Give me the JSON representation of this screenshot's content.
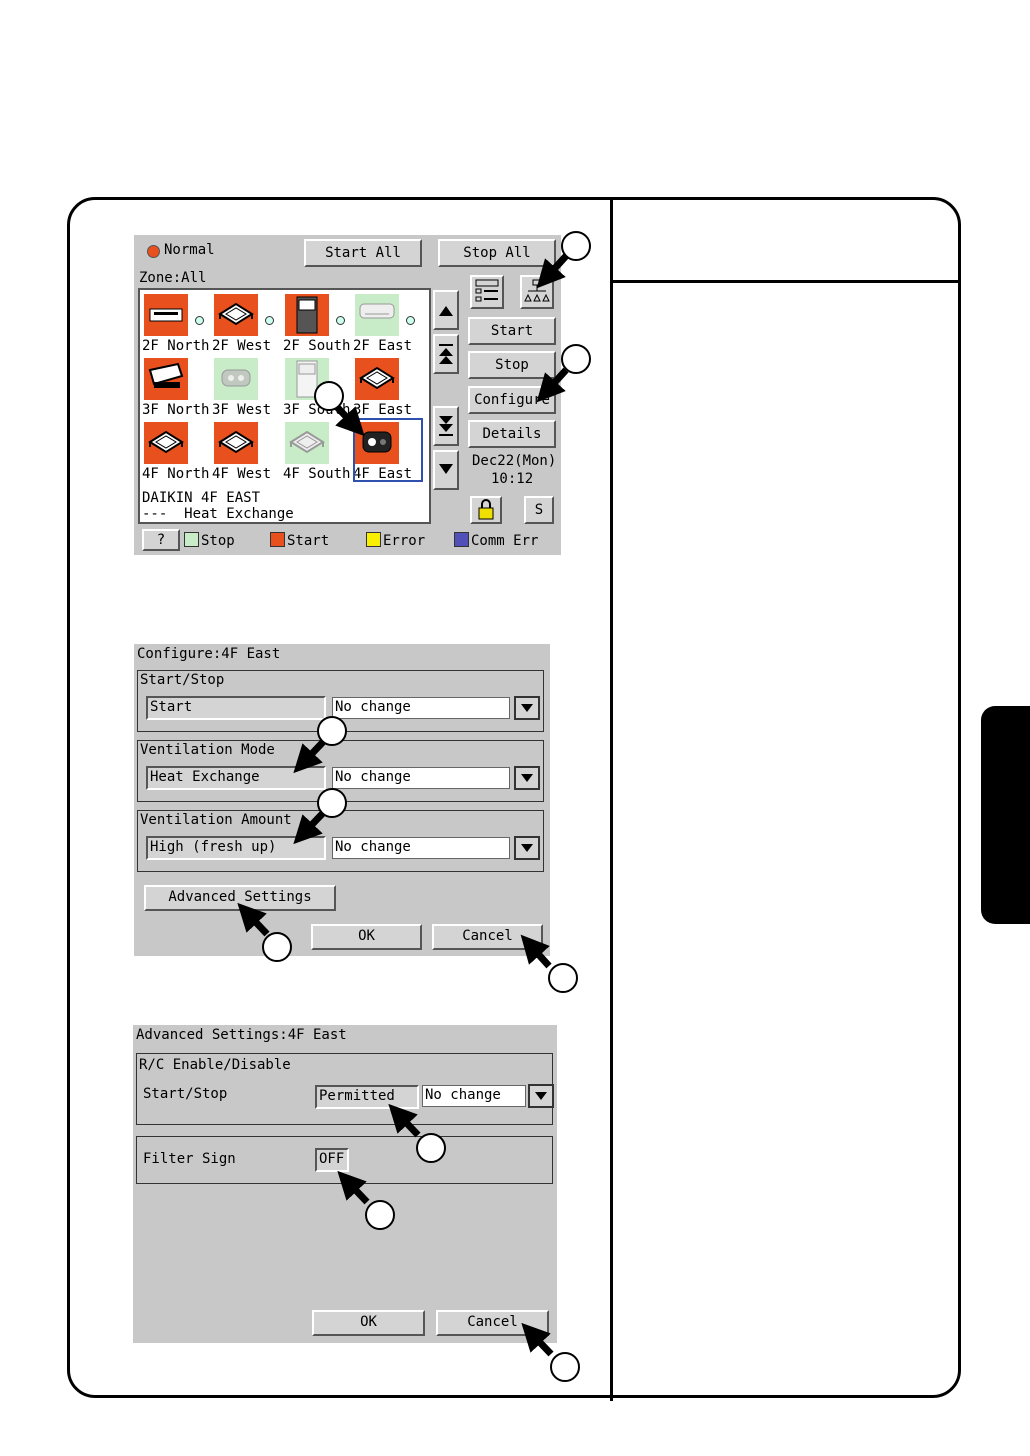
{
  "screen1": {
    "status": "Normal",
    "start_all": "Start All",
    "stop_all": "Stop All",
    "zone": "Zone:All",
    "units": [
      {
        "label": "2F North",
        "state": "start",
        "type": "cassette-flat"
      },
      {
        "label": "2F West",
        "state": "start",
        "type": "cassette"
      },
      {
        "label": "2F South",
        "state": "start",
        "type": "floor"
      },
      {
        "label": "2F East",
        "state": "stop",
        "type": "wall"
      },
      {
        "label": "3F North",
        "state": "start",
        "type": "ceiling"
      },
      {
        "label": "3F West",
        "state": "stop",
        "type": "duct"
      },
      {
        "label": "3F South",
        "state": "stop",
        "type": "floor"
      },
      {
        "label": "3F East",
        "state": "start",
        "type": "cassette"
      },
      {
        "label": "4F North",
        "state": "start",
        "type": "cassette"
      },
      {
        "label": "4F West",
        "state": "start",
        "type": "cassette"
      },
      {
        "label": "4F South",
        "state": "stop",
        "type": "cassette"
      },
      {
        "label": "4F East",
        "state": "start",
        "type": "ventilator"
      }
    ],
    "selected_line1": "DAIKIN 4F EAST",
    "selected_line2": "---  Heat Exchange",
    "buttons": {
      "start": "Start",
      "stop": "Stop",
      "configure": "Configure",
      "details": "Details",
      "s": "S",
      "help": "?"
    },
    "date": "Dec22(Mon)",
    "time": "10:12",
    "legend": [
      {
        "label": "Stop",
        "color": "#c8ecc8"
      },
      {
        "label": "Start",
        "color": "#e8501e"
      },
      {
        "label": "Error",
        "color": "#f8f000"
      },
      {
        "label": "Comm Err",
        "color": "#5050b8"
      }
    ]
  },
  "screen2": {
    "title": "Configure:4F East",
    "groups": [
      {
        "title": "Start/Stop",
        "current": "Start",
        "select": "No change"
      },
      {
        "title": "Ventilation Mode",
        "current": "Heat Exchange",
        "select": "No change"
      },
      {
        "title": "Ventilation Amount",
        "current": "High (fresh up)",
        "select": "No change"
      }
    ],
    "advanced": "Advanced Settings",
    "ok": "OK",
    "cancel": "Cancel"
  },
  "screen3": {
    "title": "Advanced Settings:4F East",
    "rc_group": "R/C Enable/Disable",
    "start_stop_label": "Start/Stop",
    "start_stop_value": "Permitted",
    "start_stop_select": "No change",
    "filter_label": "Filter Sign",
    "filter_value": "OFF",
    "ok": "OK",
    "cancel": "Cancel"
  },
  "colors": {
    "panel": "#c8c8c8",
    "start": "#e8501e",
    "stop": "#c8ecc8",
    "error": "#f8f000",
    "comm_err": "#5050b8"
  }
}
